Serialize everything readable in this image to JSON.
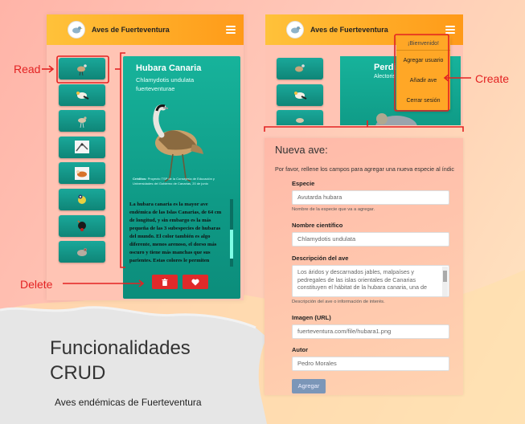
{
  "app": {
    "title": "Aves de Fuerteventura",
    "menu_icon": "hamburger-menu-icon",
    "logo_icon": "bird-logo-icon"
  },
  "colors": {
    "header_start": "#ffc23a",
    "header_end": "#ff9a18",
    "card": "#14a893",
    "delete_btn": "#e02a2a",
    "annotation": "#e32222",
    "submit_btn": "#7b96b8"
  },
  "annotations": {
    "read": "Read",
    "create": "Create",
    "delete": "Delete"
  },
  "caption": {
    "title": "Funcionalidades CRUD",
    "subtitle": "Aves endémicas de Fuerteventura"
  },
  "thumbnails": [
    {
      "icon": "hubara-bird-icon"
    },
    {
      "icon": "egyptian-vulture-icon"
    },
    {
      "icon": "cream-courser-icon"
    },
    {
      "icon": "bird-photo-icon"
    },
    {
      "icon": "ruddy-shelduck-icon"
    },
    {
      "icon": "blue-tit-icon"
    },
    {
      "icon": "black-bird-icon"
    },
    {
      "icon": "partridge-icon"
    }
  ],
  "detail": {
    "name": "Hubara Canaria",
    "scientific": "Chlamydotis undulata fuerteventurae",
    "credit_label": "Créditos:",
    "credit_text": "Proyecto TSP de la Consejería de Educación y Universidades del Gobierno de Canarias, 20 de junio",
    "description": "La hubara canaria es la mayor ave endémica de las Islas Canarias, de 64 cm de longitud, y sin embargo es la más pequeña de las 3 subespecies de hubaras del mundo. El color también es algo diferente, menos arenoso, el dorso más oscuro y tiene más manchas que sus parientes. Estas colores le permiten",
    "delete_icon": "trash-icon",
    "like_icon": "heart-icon"
  },
  "second_view": {
    "card_name": "Perdiz",
    "card_scientific": "Alectoris",
    "dropdown": {
      "greeting": "¡Bienvenido!",
      "items": [
        "Agregar usuario",
        "Añadir ave",
        "Cerrar sesión"
      ]
    }
  },
  "form": {
    "title": "Nueva ave:",
    "intro": "Por favor, rellene los campos para agregar una nueva especie al índic",
    "especie": {
      "label": "Especie",
      "value": "Avutarda hubara",
      "help": "Nombre de la especie que va a agregar."
    },
    "nombre_cientifico": {
      "label": "Nombre científico",
      "value": "Chlamydotis undulata"
    },
    "descripcion": {
      "label": "Descripción del ave",
      "value": "Los áridos y descarnados jables, malpaíses y pedregales de las islas orientales de Canarias constituyen el hábitat de la hubara canaria, una de",
      "help": "Descripción del ave o información de interés."
    },
    "imagen": {
      "label": "Imagen (URL)",
      "value": "fuerteventura.com/file/hubara1.png"
    },
    "autor": {
      "label": "Autor",
      "value": "Pedro Morales"
    },
    "submit": "Agregar"
  }
}
